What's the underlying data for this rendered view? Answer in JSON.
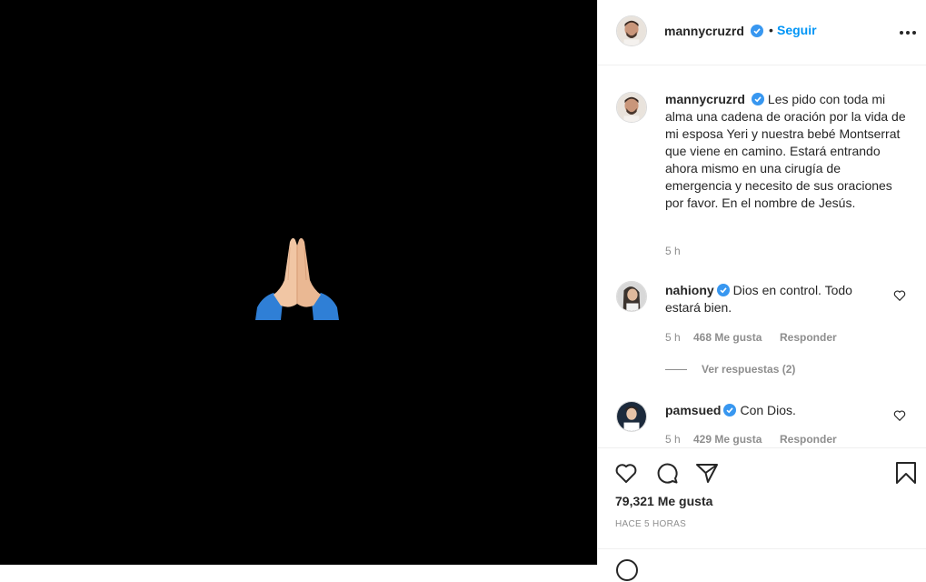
{
  "post": {
    "username": "mannycruzrd",
    "follow_label": "Seguir",
    "dot": "•"
  },
  "caption": {
    "username": "mannycruzrd",
    "text": "Les pido con toda mi alma una cadena de oración por la vida de mi esposa Yeri y nuestra bebé Montserrat que viene en camino. Estará entrando ahora mismo en una cirugía de emergencia y necesito de sus oraciones por favor. En el nombre de Jesús.",
    "time": "5 h"
  },
  "comments": [
    {
      "username": "nahiony",
      "text": "Dios en control. Todo estará bien.",
      "time": "5 h",
      "likes": "468 Me gusta",
      "reply_label": "Responder",
      "view_replies": "Ver respuestas (2)"
    },
    {
      "username": "pamsued",
      "text": "Con Dios.",
      "time": "5 h",
      "likes": "429 Me gusta",
      "reply_label": "Responder"
    }
  ],
  "footer": {
    "likes": "79,321 Me gusta",
    "time_ago": "HACE 5 HORAS"
  },
  "icons": {
    "media": "folded-hands-emoji",
    "verified": "verified-badge-icon",
    "more": "more-options-icon",
    "like": "heart-icon",
    "comment": "comment-icon",
    "share": "share-icon",
    "save": "bookmark-icon",
    "emoji": "emoji-icon"
  },
  "colors": {
    "accent": "#0095f6",
    "media_bg": "#000000",
    "text": "#262626",
    "secondary": "#8e8e8e"
  }
}
